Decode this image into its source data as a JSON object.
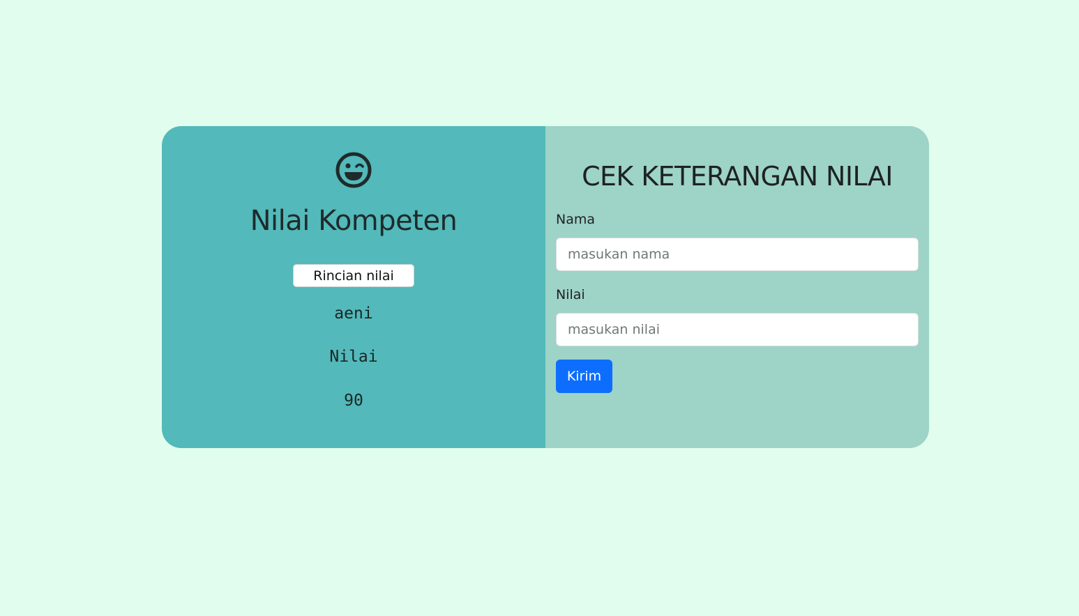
{
  "result_panel": {
    "icon": "winking-face-icon",
    "title": "Nilai Kompeten",
    "detail_button_label": "Rincian nilai",
    "name_value": "aeni",
    "score_label": "Nilai",
    "score_value": "90"
  },
  "form_panel": {
    "title": "CEK KETERANGAN NILAI",
    "name_label": "Nama",
    "name_placeholder": "masukan nama",
    "score_label": "Nilai",
    "score_placeholder": "masukan nilai",
    "submit_label": "Kirim"
  },
  "colors": {
    "background": "#e0fdee",
    "left_panel": "#53b9ba",
    "right_panel": "#9ed3c7",
    "submit_button": "#0d6efd"
  }
}
